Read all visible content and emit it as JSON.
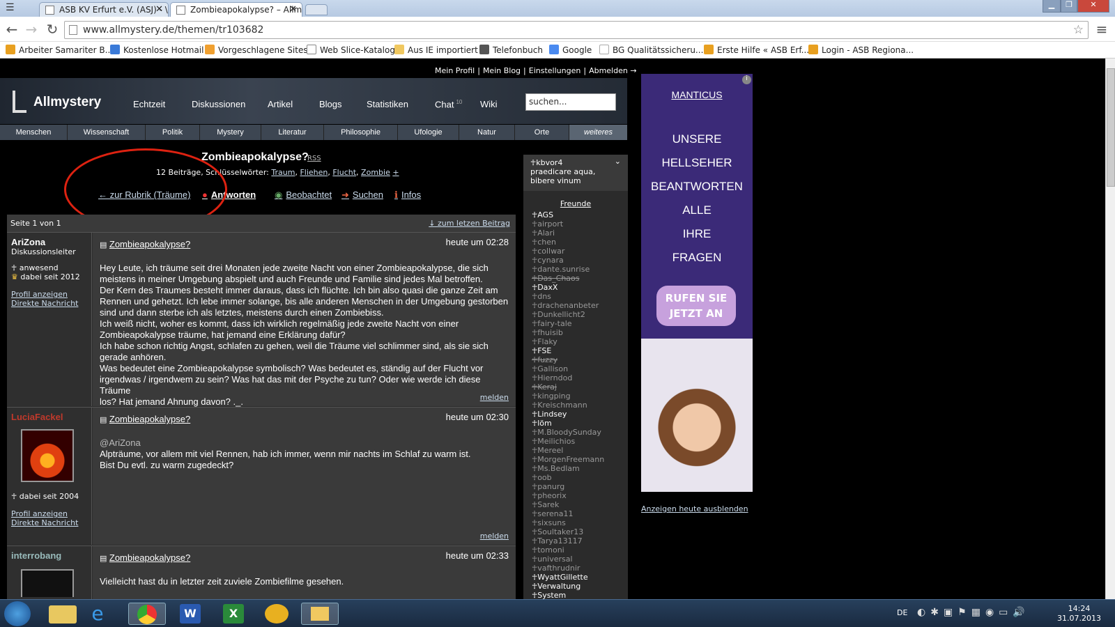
{
  "browser": {
    "tabs": [
      {
        "title": "ASB KV Erfurt e.V. (ASJ) - \\"
      },
      {
        "title": "Zombieapokalypse? – Allm"
      }
    ],
    "url": "www.allmystery.de/themen/tr103682",
    "bookmarks": [
      "Arbeiter Samariter B...",
      "Kostenlose Hotmail",
      "Vorgeschlagene Sites",
      "Web Slice-Katalog",
      "Aus IE importiert",
      "Telefonbuch",
      "Google",
      "BG Qualitätssicheru...",
      "Erste Hilfe « ASB Erf...",
      "Login - ASB Regiona..."
    ]
  },
  "topnav": [
    "Mein Profil",
    "Mein Blog",
    "Einstellungen",
    "Abmelden →"
  ],
  "site": {
    "logo": "Allmystery",
    "nav": [
      "Echtzeit",
      "Diskussionen",
      "Artikel",
      "Blogs",
      "Statistiken",
      "Chat",
      "Wiki"
    ],
    "chat_count": "10",
    "search_placeholder": "suchen...",
    "categories": [
      "Menschen",
      "Wissenschaft",
      "Politik",
      "Mystery",
      "Literatur",
      "Philosophie",
      "Ufologie",
      "Natur",
      "Orte",
      "weiteres"
    ]
  },
  "thread": {
    "title": "Zombieapokalypse?",
    "rss": "RSS",
    "meta_prefix": "12 Beiträge, Schlüsselwörter:",
    "keywords": [
      "Traum",
      "Fliehen",
      "Flucht",
      "Zombie"
    ],
    "keyword_plus": "+",
    "actions": [
      "← zur Rubrik (Träume)",
      "Antworten",
      "Beobachtet",
      "Suchen",
      "Infos"
    ],
    "page_info": "Seite 1 von 1",
    "last_post": "↓ zum letzen Beitrag"
  },
  "posts": [
    {
      "user": "AriZona",
      "role": "Diskussionsleiter",
      "status": "anwesend",
      "since": "dabei seit 2012",
      "title": "Zombieapokalypse?",
      "time": "heute um 02:28",
      "body": "Hey Leute, ich träume seit drei Monaten jede zweite Nacht von einer Zombieapokalypse, die sich\nmeistens in meiner Umgebung abspielt und auch Freunde und Familie sind jedes Mal betroffen.\nDer Kern des Traumes besteht immer daraus, dass ich flüchte. Ich bin also quasi die ganze Zeit am\nRennen und gehetzt. Ich lebe immer solange, bis alle anderen Menschen in der Umgebung gestorben\nsind und dann sterbe ich als letztes, meistens durch einen Zombiebiss.\nIch weiß nicht, woher es kommt, dass ich wirklich regelmäßig jede zweite Nacht von einer\nZombieapokalypse träume, hat jemand eine Erklärung dafür?\nIch habe schon richtig Angst, schlafen zu gehen, weil die Träume viel schlimmer sind, als sie sich\ngerade anhören.\nWas bedeutet eine Zombieapokalypse symbolisch? Was bedeutet es, ständig auf der Flucht vor\nirgendwas / irgendwem zu sein? Was hat das mit der Psyche zu tun? Oder wie werde ich diese Träume\nlos? Hat jemand Ahnung davon? ._.",
      "profile": "Profil anzeigen",
      "message": "Direkte Nachricht",
      "report": "melden"
    },
    {
      "user": "LuciaFackel",
      "since": "dabei seit 2004",
      "title": "Zombieapokalypse?",
      "time": "heute um 02:30",
      "mention": "@AriZona",
      "body": "Alpträume, vor allem mit viel Rennen, hab ich immer, wenn mir nachts im Schlaf zu warm ist.\nBist Du evtl. zu warm zugedeckt?",
      "profile": "Profil anzeigen",
      "message": "Direkte Nachricht",
      "report": "melden"
    },
    {
      "user": "interrobang",
      "title": "Zombieapokalypse?",
      "time": "heute um 02:33",
      "body": "Vielleicht hast du in letzter zeit zuviele Zombiefilme gesehen."
    }
  ],
  "sidebar": {
    "user": "kbvor4",
    "motto": "praedicare aqua, bibere vinum",
    "friends_title": "Freunde",
    "friends": [
      {
        "n": "AGS",
        "s": "on"
      },
      {
        "n": "airport"
      },
      {
        "n": "Alari"
      },
      {
        "n": "chen"
      },
      {
        "n": "collwar"
      },
      {
        "n": "cynara"
      },
      {
        "n": "dante.sunrise"
      },
      {
        "n": "Das_Chaos",
        "s": "off"
      },
      {
        "n": "DaxX",
        "s": "on"
      },
      {
        "n": "dns"
      },
      {
        "n": "drachenanbeter"
      },
      {
        "n": "Dunkellicht2"
      },
      {
        "n": "fairy-tale"
      },
      {
        "n": "fhuisib"
      },
      {
        "n": "Flaky"
      },
      {
        "n": "FSE",
        "s": "on"
      },
      {
        "n": "fuzzy",
        "s": "off"
      },
      {
        "n": "Gallison"
      },
      {
        "n": "Hierndod"
      },
      {
        "n": "Keraj",
        "s": "off"
      },
      {
        "n": "kingping"
      },
      {
        "n": "Kreischmann"
      },
      {
        "n": "Lindsey",
        "s": "on"
      },
      {
        "n": "löm",
        "s": "on"
      },
      {
        "n": "M.BloodySunday"
      },
      {
        "n": "Meilichios"
      },
      {
        "n": "Mereel"
      },
      {
        "n": "MorgenFreemann"
      },
      {
        "n": "Ms.Bedlam"
      },
      {
        "n": "oob"
      },
      {
        "n": "panurg"
      },
      {
        "n": "pheorix"
      },
      {
        "n": "Sarek"
      },
      {
        "n": "serena11"
      },
      {
        "n": "sixsuns"
      },
      {
        "n": "Soultaker13"
      },
      {
        "n": "Tarya13117"
      },
      {
        "n": "tomoni"
      },
      {
        "n": "universal"
      },
      {
        "n": "vafthrudnir"
      },
      {
        "n": "WyattGillette",
        "s": "on"
      },
      {
        "n": "Verwaltung",
        "s": "on"
      },
      {
        "n": "System",
        "s": "on"
      }
    ]
  },
  "ad": {
    "brand": "MANTICUS",
    "lines": [
      "UNSERE",
      "HELLSEHER",
      "BEANTWORTEN",
      "ALLE",
      "IHRE",
      "FRAGEN"
    ],
    "button": "RUFEN SIE JETZT AN",
    "hide": "Anzeigen heute ausblenden"
  },
  "taskbar": {
    "lang": "DE",
    "time": "14:24",
    "date": "31.07.2013"
  },
  "colors": {
    "accent_red": "#d21",
    "link": "#ccddee",
    "ad_purple": "#3b2a78",
    "luciafackel": "#c0392b",
    "interrobang": "#9bb"
  }
}
